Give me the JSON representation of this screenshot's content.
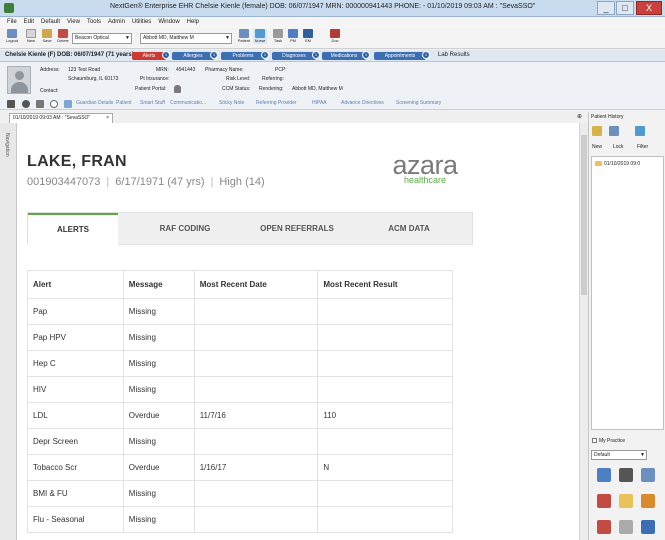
{
  "window": {
    "title": "NextGen® Enterprise EHR Chelsie Kienle  (female)  DOB: 06/07/1947  MRN: 000000941443  PHONE:  - 01/10/2019 09:03 AM : \"SevaSSO\"",
    "min_label": "_",
    "max_label": "□",
    "close_label": "X"
  },
  "menu": [
    "File",
    "Edit",
    "Default",
    "View",
    "Tools",
    "Admin",
    "Utilities",
    "Window",
    "Help"
  ],
  "toolbar": {
    "buttons": [
      {
        "label": "Logout",
        "icon": "logout-icon",
        "color": "#6b8fbf"
      },
      {
        "label": "New",
        "icon": "new-doc-icon",
        "color": "#d7d7d7"
      },
      {
        "label": "Save",
        "icon": "save-icon",
        "color": "#d1a64a"
      },
      {
        "label": "Delete",
        "icon": "delete-icon",
        "color": "#c24b42"
      }
    ],
    "location": "Beacon Optical",
    "provider": "Abbott MD, Matthew M",
    "right_buttons": [
      {
        "label": "Patient",
        "icon": "patient-icon",
        "color": "#6b8fbf"
      },
      {
        "label": "Nurse",
        "icon": "nurse-icon",
        "color": "#4f9bd1"
      },
      {
        "label": "Task",
        "icon": "task-icon",
        "color": "#9a9a9a"
      },
      {
        "label": "PM",
        "icon": "pm-icon",
        "color": "#4e7fc2"
      },
      {
        "label": "EM",
        "icon": "em-icon",
        "color": "#2f5f9f"
      },
      {
        "label": "Doc",
        "icon": "doc-icon",
        "color": "#b33b36"
      }
    ]
  },
  "patient_bar": {
    "info": "Chelsie Kienle  (F)  DOB:  06/07/1947 (71 years)",
    "pills": [
      {
        "label": "Alerts",
        "color": "#c93a33",
        "badge": "1"
      },
      {
        "label": "Allergies",
        "color": "#3c6eb4",
        "badge": "1"
      },
      {
        "label": "Problems",
        "color": "#3c6eb4",
        "badge": "1"
      },
      {
        "label": "Diagnoses",
        "color": "#3c6eb4",
        "badge": "1"
      },
      {
        "label": "Medications",
        "color": "#3c6eb4",
        "badge": "1"
      },
      {
        "label": "Appointments",
        "color": "#3c6eb4",
        "badge": "1"
      }
    ],
    "lab_results": "Lab Results"
  },
  "demographics": {
    "address_label": "Address:",
    "address_line1": "123 Test Road",
    "address_line2": "Schaumburg, IL 60173",
    "contact_label": "Contact:",
    "mrn_label": "MRN:",
    "mrn_value": "4941443",
    "pt_insurance_label": "Pt Insurance:",
    "patient_portal_label": "Patient Portal:",
    "pharmacy_label": "Pharmacy Name:",
    "risk_label": "Risk Level:",
    "ccm_label": "CCM Status:",
    "pcp_label": "PCP:",
    "referring_label": "Referring:",
    "rendering_label": "Rendering:",
    "rendering_value": "Abbott MD, Matthew M"
  },
  "quick_links": [
    "Guardian Details",
    "Patient",
    "Smart Stuff",
    "Communicatio...",
    "Sticky Note",
    "Referring Provider",
    "HIPAA",
    "Advance Directives",
    "Screening Summary"
  ],
  "document_tab": "01/10/2019 09:03 AM : \"SevaSSO\"",
  "rail_label": "Navigation",
  "patient": {
    "name": "LAKE, FRAN",
    "id": "001903447073",
    "dob": "6/17/1971 (47 yrs)",
    "risk": "High (14)"
  },
  "brand": {
    "word": "azara",
    "sub": "healthcare",
    "color": "#5aab46"
  },
  "tabs": [
    "ALERTS",
    "RAF CODING",
    "OPEN REFERRALS",
    "ACM DATA"
  ],
  "alerts_table": {
    "columns": [
      "Alert",
      "Message",
      "Most Recent Date",
      "Most Recent Result"
    ],
    "rows": [
      [
        "Pap",
        "Missing",
        "",
        ""
      ],
      [
        "Pap HPV",
        "Missing",
        "",
        ""
      ],
      [
        "Hep C",
        "Missing",
        "",
        ""
      ],
      [
        "HIV",
        "Missing",
        "",
        ""
      ],
      [
        "LDL",
        "Overdue",
        "11/7/16",
        "110"
      ],
      [
        "Depr Screen",
        "Missing",
        "",
        ""
      ],
      [
        "Tobacco Scr",
        "Overdue",
        "1/16/17",
        "N"
      ],
      [
        "BMI & FU",
        "Missing",
        "",
        ""
      ],
      [
        "Flu - Seasonal",
        "Missing",
        "",
        ""
      ]
    ]
  },
  "right_panel": {
    "header": "Patient History",
    "new_label": "New",
    "lock_label": "Lock",
    "filter_label": "Filter",
    "tree_node": "01/10/2019 09:0",
    "my_practice_label": "My Practice",
    "default_select": "Default"
  }
}
